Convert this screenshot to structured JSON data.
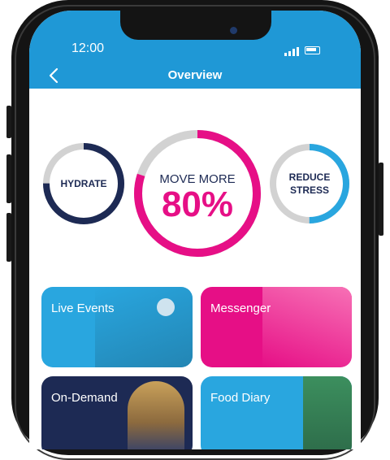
{
  "status_bar": {
    "time": "12:00"
  },
  "header": {
    "title": "Overview"
  },
  "goals": [
    {
      "label": "HYDRATE",
      "progress": 0.75,
      "color": "#1d2a54"
    },
    {
      "label_line1": "MOVE MORE",
      "percent_label": "80%",
      "progress": 0.8,
      "color": "#e60f86"
    },
    {
      "label_line1": "REDUCE",
      "label_line2": "STRESS",
      "progress": 0.5,
      "color": "#29a6df"
    }
  ],
  "tiles": [
    {
      "label": "Live Events",
      "color": "#29a6df"
    },
    {
      "label": "Messenger",
      "color": "#e60f86"
    },
    {
      "label": "On-Demand",
      "color": "#1d2a54"
    },
    {
      "label": "Food Diary",
      "color": "#29a6df"
    }
  ]
}
